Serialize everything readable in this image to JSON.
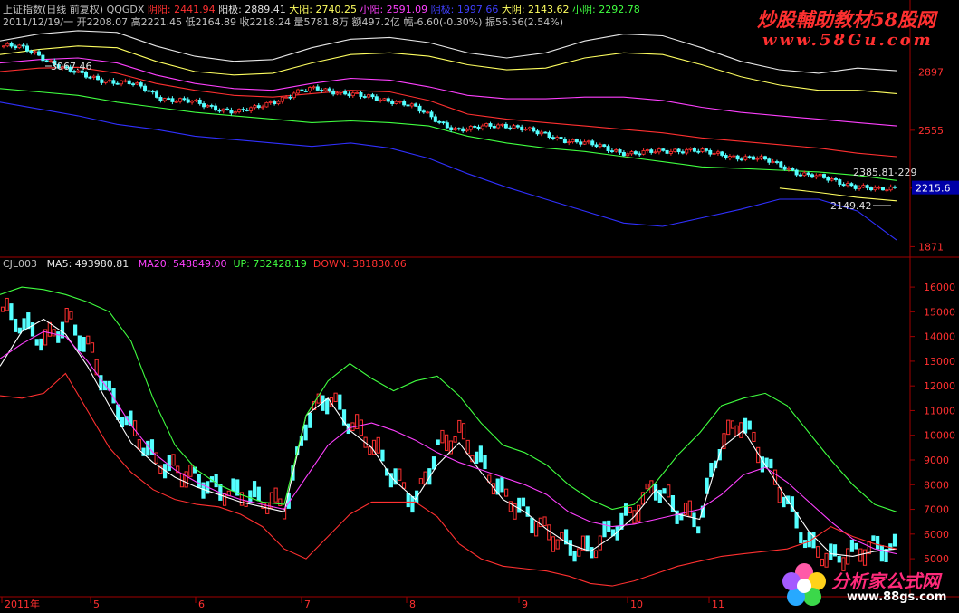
{
  "header": {
    "line1": [
      {
        "text": "上证指数(日线 前复权) QQGDX",
        "color": "#c0c0c0"
      },
      {
        "text": "阴阳: 2441.94",
        "color": "#ff3030"
      },
      {
        "text": "阳极: 2889.41",
        "color": "#e0e0e0"
      },
      {
        "text": "大阳: 2740.25",
        "color": "#ffff60"
      },
      {
        "text": "小阳: 2591.09",
        "color": "#ff40ff"
      },
      {
        "text": "阴极: 1997.66",
        "color": "#4040ff"
      },
      {
        "text": "大阴: 2143.62",
        "color": "#ffff60"
      },
      {
        "text": "小阴: 2292.78",
        "color": "#40ff40"
      }
    ],
    "line2": "2011/12/19/一 开2208.07 高2221.45 低2164.89 收2218.24 量5781.8万 额497.2亿 幅-6.60(-0.30%) 振56.56(2.54%)"
  },
  "indicator_header": {
    "name": "CJL003",
    "ma5": "MA5: 493980.81",
    "ma20": "MA20: 548849.00",
    "up": "UP: 732428.19",
    "down": "DOWN: 381830.06"
  },
  "watermark": {
    "top_title": "炒股輔助教材58股网",
    "top_url": "www.58Gu.com",
    "bottom_title": "分析家公式网",
    "bottom_url": "www.88gs.com"
  },
  "colors": {
    "up": "#ff3030",
    "down": "#54ffff",
    "grid": "#8b0000",
    "axis_text": "#ff3030",
    "price_tag_bg": "#0000a8"
  },
  "chart_data": [
    {
      "type": "candlestick",
      "title": "上证指数(日线 前复权)",
      "y_ticks": [
        2897,
        2555,
        2215,
        1871
      ],
      "price_tag": "2215.6",
      "annotations": [
        "3067.46",
        "2385.81-229",
        "2149.42"
      ],
      "ylim": [
        1820,
        3150
      ],
      "price_seed": [
        3050,
        3040,
        3010,
        2960,
        2910,
        2880,
        2860,
        2840,
        2830,
        2800,
        2750,
        2730,
        2720,
        2700,
        2680,
        2660,
        2680,
        2720,
        2750,
        2780,
        2800,
        2790,
        2770,
        2750,
        2740,
        2730,
        2700,
        2650,
        2600,
        2560,
        2560,
        2580,
        2590,
        2570,
        2540,
        2520,
        2500,
        2480,
        2460,
        2440,
        2420,
        2420,
        2430,
        2440,
        2440,
        2420,
        2410,
        2400,
        2390,
        2370,
        2340,
        2300,
        2280,
        2260,
        2240,
        2220,
        2200,
        2215
      ],
      "bands": [
        {
          "name": "阳极",
          "color": "#e8e8e8",
          "values": [
            3080,
            3120,
            3140,
            3130,
            3050,
            2990,
            2960,
            2970,
            3040,
            3090,
            3100,
            3070,
            3010,
            2980,
            3010,
            3080,
            3120,
            3110,
            3040,
            2960,
            2910,
            2890,
            2920,
            2905
          ]
        },
        {
          "name": "大阳",
          "color": "#ffff60",
          "values": [
            3000,
            3030,
            3050,
            3040,
            2960,
            2900,
            2880,
            2890,
            2950,
            3000,
            3010,
            2990,
            2940,
            2910,
            2920,
            2980,
            3010,
            3000,
            2940,
            2870,
            2820,
            2790,
            2790,
            2770
          ]
        },
        {
          "name": "小阳",
          "color": "#ff40ff",
          "values": [
            2950,
            2970,
            2980,
            2950,
            2880,
            2830,
            2800,
            2790,
            2830,
            2860,
            2850,
            2810,
            2760,
            2740,
            2740,
            2750,
            2750,
            2730,
            2690,
            2660,
            2640,
            2620,
            2600,
            2580
          ]
        },
        {
          "name": "阴阳",
          "color": "#ff3030",
          "values": [
            2900,
            2920,
            2925,
            2890,
            2830,
            2790,
            2760,
            2750,
            2770,
            2790,
            2780,
            2730,
            2650,
            2620,
            2600,
            2580,
            2560,
            2540,
            2510,
            2490,
            2470,
            2450,
            2420,
            2400
          ]
        },
        {
          "name": "小阴",
          "color": "#40ff40",
          "values": [
            2800,
            2780,
            2760,
            2720,
            2690,
            2660,
            2640,
            2620,
            2600,
            2610,
            2600,
            2580,
            2520,
            2480,
            2450,
            2430,
            2400,
            2370,
            2340,
            2330,
            2320,
            2310,
            2290,
            2260
          ]
        },
        {
          "name": "大阴",
          "color": "#ffff60",
          "values": [
            null,
            null,
            null,
            null,
            null,
            null,
            null,
            null,
            null,
            null,
            null,
            null,
            null,
            null,
            null,
            null,
            null,
            null,
            null,
            null,
            2215,
            2190,
            2160,
            2140
          ]
        },
        {
          "name": "阴极",
          "color": "#3030ff",
          "values": [
            2720,
            2680,
            2640,
            2590,
            2560,
            2520,
            2500,
            2480,
            2460,
            2480,
            2450,
            2390,
            2300,
            2220,
            2150,
            2080,
            2010,
            1990,
            2040,
            2090,
            2150,
            2150,
            2080,
            1910
          ]
        }
      ]
    },
    {
      "type": "bar",
      "title": "CJL003",
      "y_ticks": [
        16000,
        15000,
        14000,
        13000,
        12000,
        11000,
        10000,
        9000,
        8000,
        7000,
        6000,
        5000
      ],
      "ylim": [
        3500,
        16700
      ],
      "series": [
        {
          "name": "MA5",
          "color": "#ffffff",
          "values": [
            12800,
            14200,
            14700,
            14100,
            12800,
            11200,
            9700,
            8900,
            8300,
            7900,
            7600,
            7300,
            7100,
            6900,
            10800,
            11500,
            10200,
            9500,
            8200,
            7400,
            8800,
            9700,
            8500,
            7400,
            6900,
            6200,
            5600,
            5300,
            5900,
            6700,
            7800,
            6800,
            6600,
            9500,
            10200,
            8800,
            7400,
            6100,
            5200,
            5100,
            5300,
            5400
          ]
        },
        {
          "name": "MA20",
          "color": "#ff40ff",
          "values": [
            13100,
            13700,
            14200,
            14000,
            13000,
            11800,
            10400,
            9300,
            8600,
            8100,
            7700,
            7400,
            7200,
            7000,
            8300,
            9600,
            10300,
            10500,
            10200,
            9800,
            9300,
            8900,
            8600,
            8300,
            8000,
            7600,
            6900,
            6500,
            6300,
            6400,
            6600,
            6800,
            7000,
            7600,
            8400,
            8700,
            8100,
            7300,
            6500,
            5800,
            5400,
            5200
          ]
        },
        {
          "name": "UP",
          "color": "#40ff40",
          "values": [
            15700,
            16000,
            15900,
            15700,
            15400,
            15000,
            13800,
            11500,
            9600,
            8600,
            8000,
            7600,
            7300,
            7200,
            10800,
            12200,
            12900,
            12300,
            11800,
            12200,
            12400,
            11600,
            10500,
            9600,
            9300,
            8800,
            8000,
            7400,
            7000,
            7200,
            8100,
            9200,
            10100,
            11200,
            11500,
            11700,
            11200,
            10100,
            9000,
            8000,
            7200,
            6900
          ]
        },
        {
          "name": "DOWN",
          "color": "#ff3030",
          "values": [
            11600,
            11500,
            11700,
            12500,
            11000,
            9500,
            8500,
            7800,
            7400,
            7200,
            7100,
            6800,
            6300,
            5400,
            5000,
            5900,
            6800,
            7300,
            7300,
            7300,
            6700,
            5600,
            5000,
            4700,
            4600,
            4500,
            4300,
            4000,
            3900,
            4100,
            4400,
            4700,
            4900,
            5100,
            5200,
            5300,
            5400,
            5700,
            6300,
            5900,
            5600,
            5400
          ]
        }
      ],
      "volume_seed": [
        15100,
        14400,
        13800,
        14700,
        13500,
        11500,
        10200,
        9000,
        8600,
        8200,
        7800,
        7600,
        7400,
        7100,
        10700,
        11600,
        10500,
        9600,
        8300,
        7300,
        9500,
        10100,
        8900,
        7600,
        6900,
        6100,
        5500,
        5300,
        6200,
        6900,
        8000,
        7000,
        6500,
        9700,
        10600,
        9000,
        7400,
        5600,
        5000,
        5200,
        5500,
        5400
      ]
    }
  ],
  "x_axis": {
    "labels": [
      "2011年",
      "5",
      "6",
      "7",
      "8",
      "9",
      "10",
      "11"
    ]
  }
}
